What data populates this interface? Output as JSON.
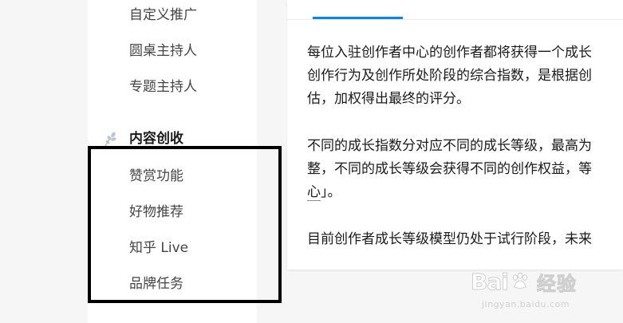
{
  "sidebar": {
    "items_top": [
      {
        "label": "自定义推广"
      },
      {
        "label": "圆桌主持人"
      },
      {
        "label": "专题主持人"
      }
    ],
    "section": {
      "title": "内容创收",
      "icon": "wheat-leaf-icon",
      "items": [
        {
          "label": "赞赏功能"
        },
        {
          "label": "好物推荐"
        },
        {
          "label": "知乎 Live"
        },
        {
          "label": "品牌任务"
        }
      ]
    }
  },
  "content": {
    "paragraphs": [
      {
        "lines": [
          "每位入驻创作者中心的创作者都将获得一个成长",
          "创作行为及创作所处阶段的综合指数，是根据创",
          "估，加权得出最终的评分。"
        ]
      },
      {
        "lines": [
          "不同的成长指数分对应不同的成长等级，最高为",
          "整，不同的成长等级会获得不同的创作权益，等"
        ],
        "link_text": "心",
        "link_suffix": "」。"
      },
      {
        "lines": [
          "目前创作者成长等级模型仍处于试行阶段，未来"
        ]
      }
    ]
  },
  "watermark": {
    "logo_left": "Bai",
    "logo_right": "经验",
    "url": "jingyan.baidu.com"
  },
  "colors": {
    "accent": "#0084ff",
    "highlight_border": "#000000",
    "sidebar_bg": "#ffffff",
    "page_bg": "#f6f6f6"
  }
}
